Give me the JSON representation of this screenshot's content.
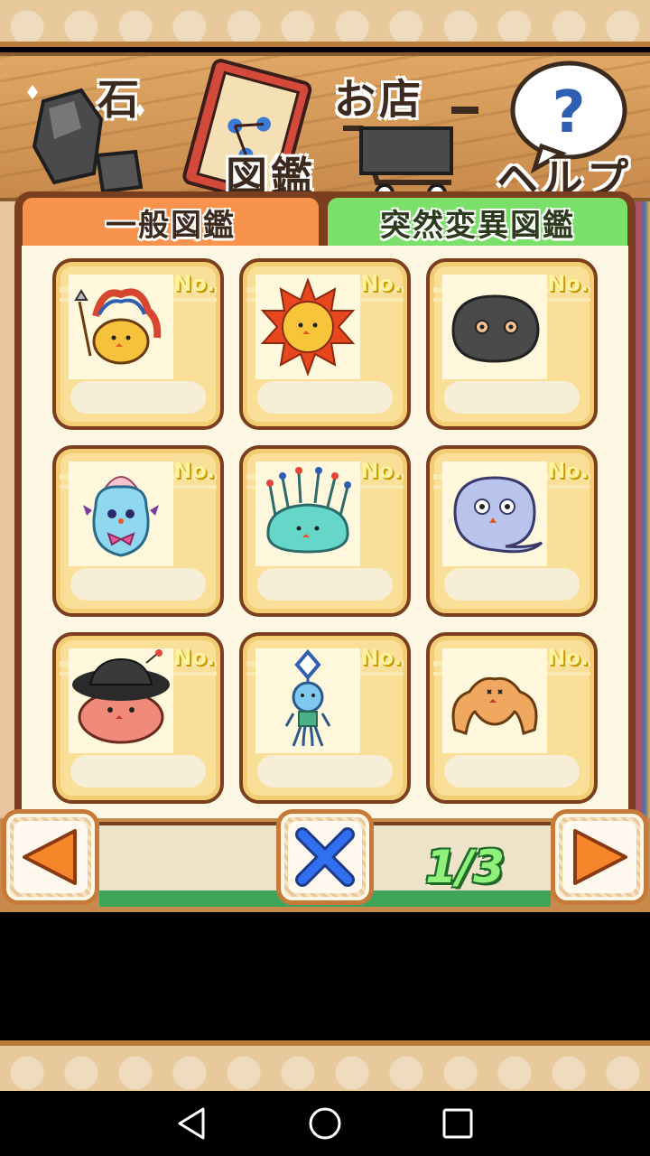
{
  "top_menu": {
    "stone_label": "石",
    "book_label": "図鑑",
    "shop_label": "お店",
    "help_label": "ヘルプ"
  },
  "tabs": [
    {
      "label": "一般図鑑",
      "active": false
    },
    {
      "label": "突然変異図鑑",
      "active": true
    }
  ],
  "cards": [
    {
      "no_label": "No.",
      "creature_icon": "chief-creature-icon"
    },
    {
      "no_label": "No.",
      "creature_icon": "sun-creature-icon"
    },
    {
      "no_label": "No.",
      "creature_icon": "dark-blob-creature-icon"
    },
    {
      "no_label": "No.",
      "creature_icon": "clown-creature-icon"
    },
    {
      "no_label": "No.",
      "creature_icon": "anemone-creature-icon"
    },
    {
      "no_label": "No.",
      "creature_icon": "ghost-creature-icon"
    },
    {
      "no_label": "No.",
      "creature_icon": "hat-creature-icon"
    },
    {
      "no_label": "No.",
      "creature_icon": "squid-creature-icon"
    },
    {
      "no_label": "No.",
      "creature_icon": "muscle-creature-icon"
    }
  ],
  "pagination": {
    "page_text": "1/3"
  },
  "colors": {
    "panel_border": "#7b3e1e",
    "tab_general": "#f7934d",
    "tab_mutation": "#7be06a",
    "card_fill": "#f9df97",
    "page_indicator": "#8ff07a"
  }
}
